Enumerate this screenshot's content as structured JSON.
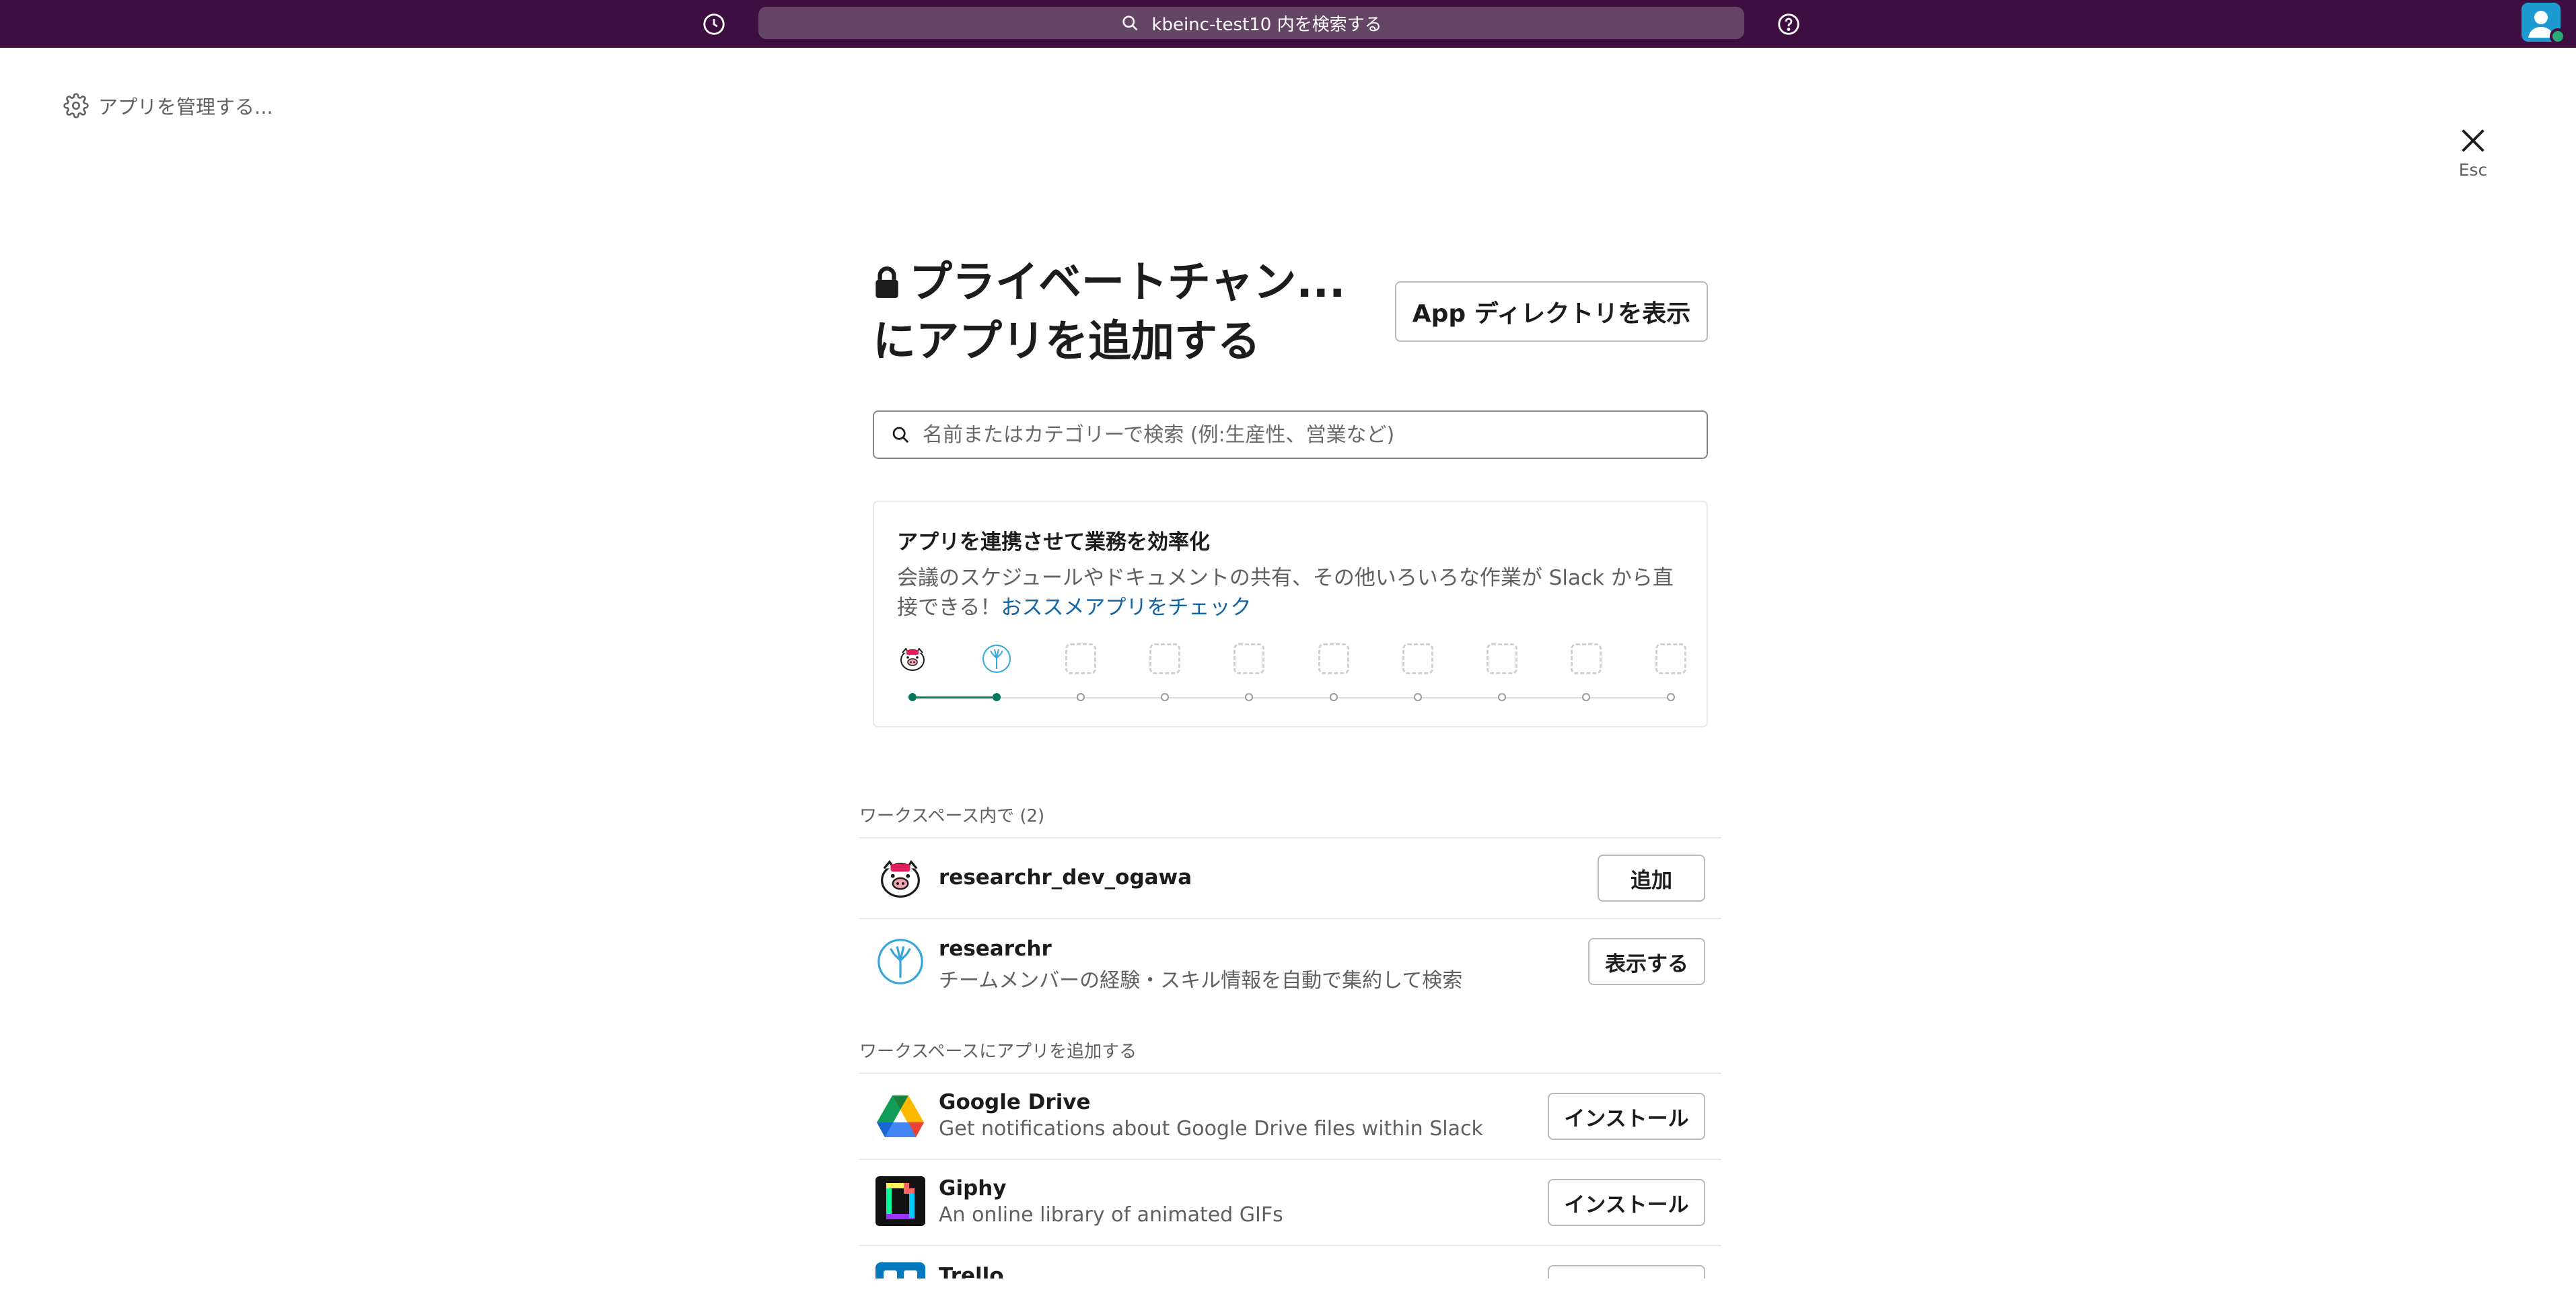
{
  "topbar": {
    "search_text": "kbeinc-test10 内を検索する",
    "history_icon": "clock-icon",
    "help_icon": "question-mark-icon",
    "presence_color": "#2bac76"
  },
  "modal": {
    "manage_apps": "アプリを管理する...",
    "close_hint": "Esc",
    "title_line1": "プライベートチャン...",
    "title_line2": "にアプリを追加する",
    "directory_button": "App ディレクトリを表示",
    "search_placeholder": "名前またはカテゴリーで検索 (例:生産性、営業など)"
  },
  "promo": {
    "heading": "アプリを連携させて業務を効率化",
    "body": "会議のスケジュールやドキュメントの共有、その他いろいろな作業が Slack から直接できる！",
    "link": "おススメアプリをチェック",
    "completed_steps": 2,
    "total_steps": 10
  },
  "workspace_section": {
    "label": "ワークスペース内で (2)",
    "apps": [
      {
        "name": "researchr_dev_ogawa",
        "description": "",
        "button": "追加"
      },
      {
        "name": "researchr",
        "description": "チームメンバーの経験・スキル情報を自動で集約して検索",
        "button": "表示する"
      }
    ]
  },
  "install_section": {
    "label": "ワークスペースにアプリを追加する",
    "apps": [
      {
        "name": "Google Drive",
        "description": "Get notifications about Google Drive files within Slack",
        "button": "インストール"
      },
      {
        "name": "Giphy",
        "description": "An online library of animated GIFs",
        "button": "インストール"
      },
      {
        "name": "Trello",
        "description": "",
        "button": ""
      }
    ]
  },
  "colors": {
    "topbar_bg": "#3f0e40",
    "link": "#1264a3",
    "progress": "#007a5a"
  }
}
